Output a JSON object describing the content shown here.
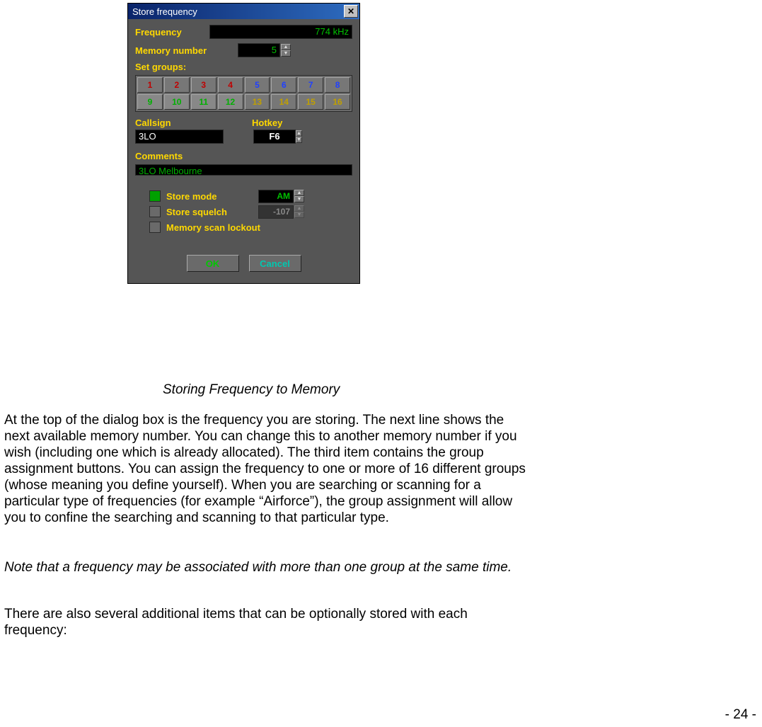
{
  "dialog": {
    "title": "Store frequency",
    "close_glyph": "✕",
    "frequency": {
      "label": "Frequency",
      "value": "774 kHz"
    },
    "memory": {
      "label": "Memory number",
      "value": "5"
    },
    "set_groups_label": "Set groups:",
    "groups": [
      {
        "n": "1",
        "cls": "g-red"
      },
      {
        "n": "2",
        "cls": "g-red"
      },
      {
        "n": "3",
        "cls": "g-red"
      },
      {
        "n": "4",
        "cls": "g-red"
      },
      {
        "n": "5",
        "cls": "g-blue"
      },
      {
        "n": "6",
        "cls": "g-blue"
      },
      {
        "n": "7",
        "cls": "g-blue"
      },
      {
        "n": "8",
        "cls": "g-blue"
      },
      {
        "n": "9",
        "cls": "g-green"
      },
      {
        "n": "10",
        "cls": "g-green"
      },
      {
        "n": "11",
        "cls": "g-green"
      },
      {
        "n": "12",
        "cls": "g-green"
      },
      {
        "n": "13",
        "cls": "g-gold"
      },
      {
        "n": "14",
        "cls": "g-gold"
      },
      {
        "n": "15",
        "cls": "g-gold"
      },
      {
        "n": "16",
        "cls": "g-gold"
      }
    ],
    "callsign": {
      "label": "Callsign",
      "value": "3LO"
    },
    "hotkey": {
      "label": "Hotkey",
      "value": "F6"
    },
    "comments": {
      "label": "Comments",
      "value": "3LO Melbourne"
    },
    "store_mode": {
      "label": "Store mode",
      "value": "AM",
      "checked": true
    },
    "store_squelch": {
      "label": "Store squelch",
      "value": "-107",
      "checked": false
    },
    "mem_lockout": {
      "label": "Memory scan lockout",
      "checked": false
    },
    "ok": "OK",
    "cancel": "Cancel",
    "spin_up": "▲",
    "spin_down": "▼"
  },
  "doc": {
    "caption": "Storing Frequency to Memory",
    "para1": "At the top of the dialog box is the frequency you are storing. The next line shows the next available memory number. You can change this to another memory number if you wish (including one which is already allocated). The third item contains the group assignment buttons. You can assign the frequency to one or more of 16 different groups (whose meaning you define yourself).  When you are searching or scanning for a particular type of frequencies (for example “Airforce”), the group assignment will allow you to confine the searching and scanning to that particular type.",
    "para2": "Note that a frequency may be associated with more than one group at the same time.",
    "para3": "There are also several additional items that can be optionally stored with each frequency:",
    "pagenum": "- 24 -"
  }
}
